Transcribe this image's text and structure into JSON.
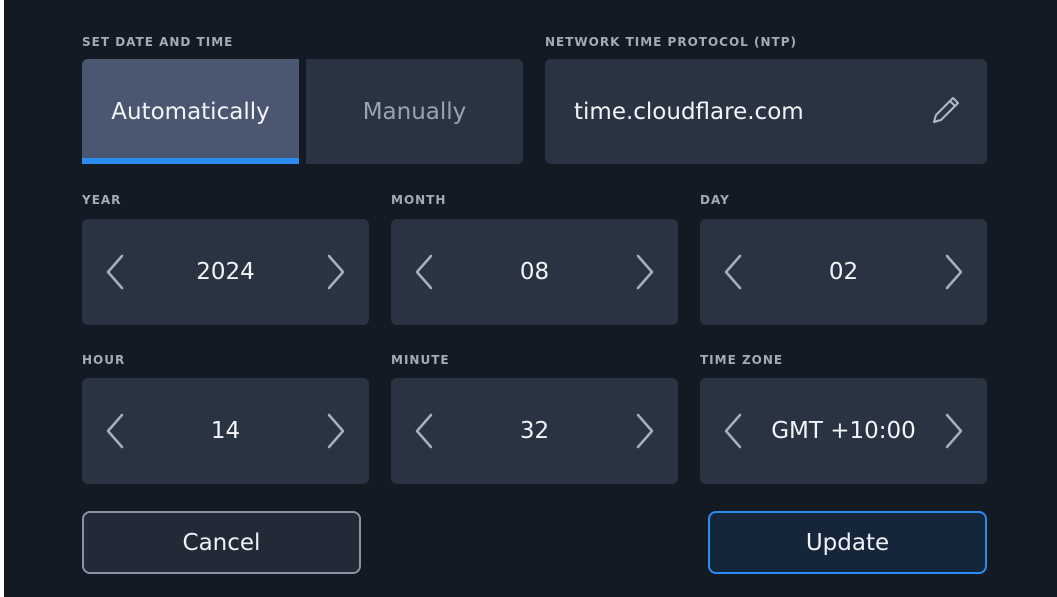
{
  "date_time_mode": {
    "label": "SET DATE AND TIME",
    "options": [
      "Automatically",
      "Manually"
    ],
    "selected": "Automatically"
  },
  "ntp": {
    "label": "NETWORK TIME PROTOCOL (NTP)",
    "value": "time.cloudflare.com",
    "edit_icon": "pencil-icon"
  },
  "year": {
    "label": "YEAR",
    "value": "2024"
  },
  "month": {
    "label": "MONTH",
    "value": "08"
  },
  "day": {
    "label": "DAY",
    "value": "02"
  },
  "hour": {
    "label": "HOUR",
    "value": "14"
  },
  "minute": {
    "label": "MINUTE",
    "value": "32"
  },
  "time_zone": {
    "label": "TIME ZONE",
    "value": "GMT +10:00"
  },
  "buttons": {
    "cancel": "Cancel",
    "update": "Update"
  },
  "colors": {
    "background": "#141a24",
    "tile": "#2a3342",
    "selected_segment": "#4b5670",
    "accent": "#2b8cf0",
    "label_text": "#a3abb8"
  },
  "icons": {
    "previous": "chevron-left-icon",
    "next": "chevron-right-icon"
  }
}
